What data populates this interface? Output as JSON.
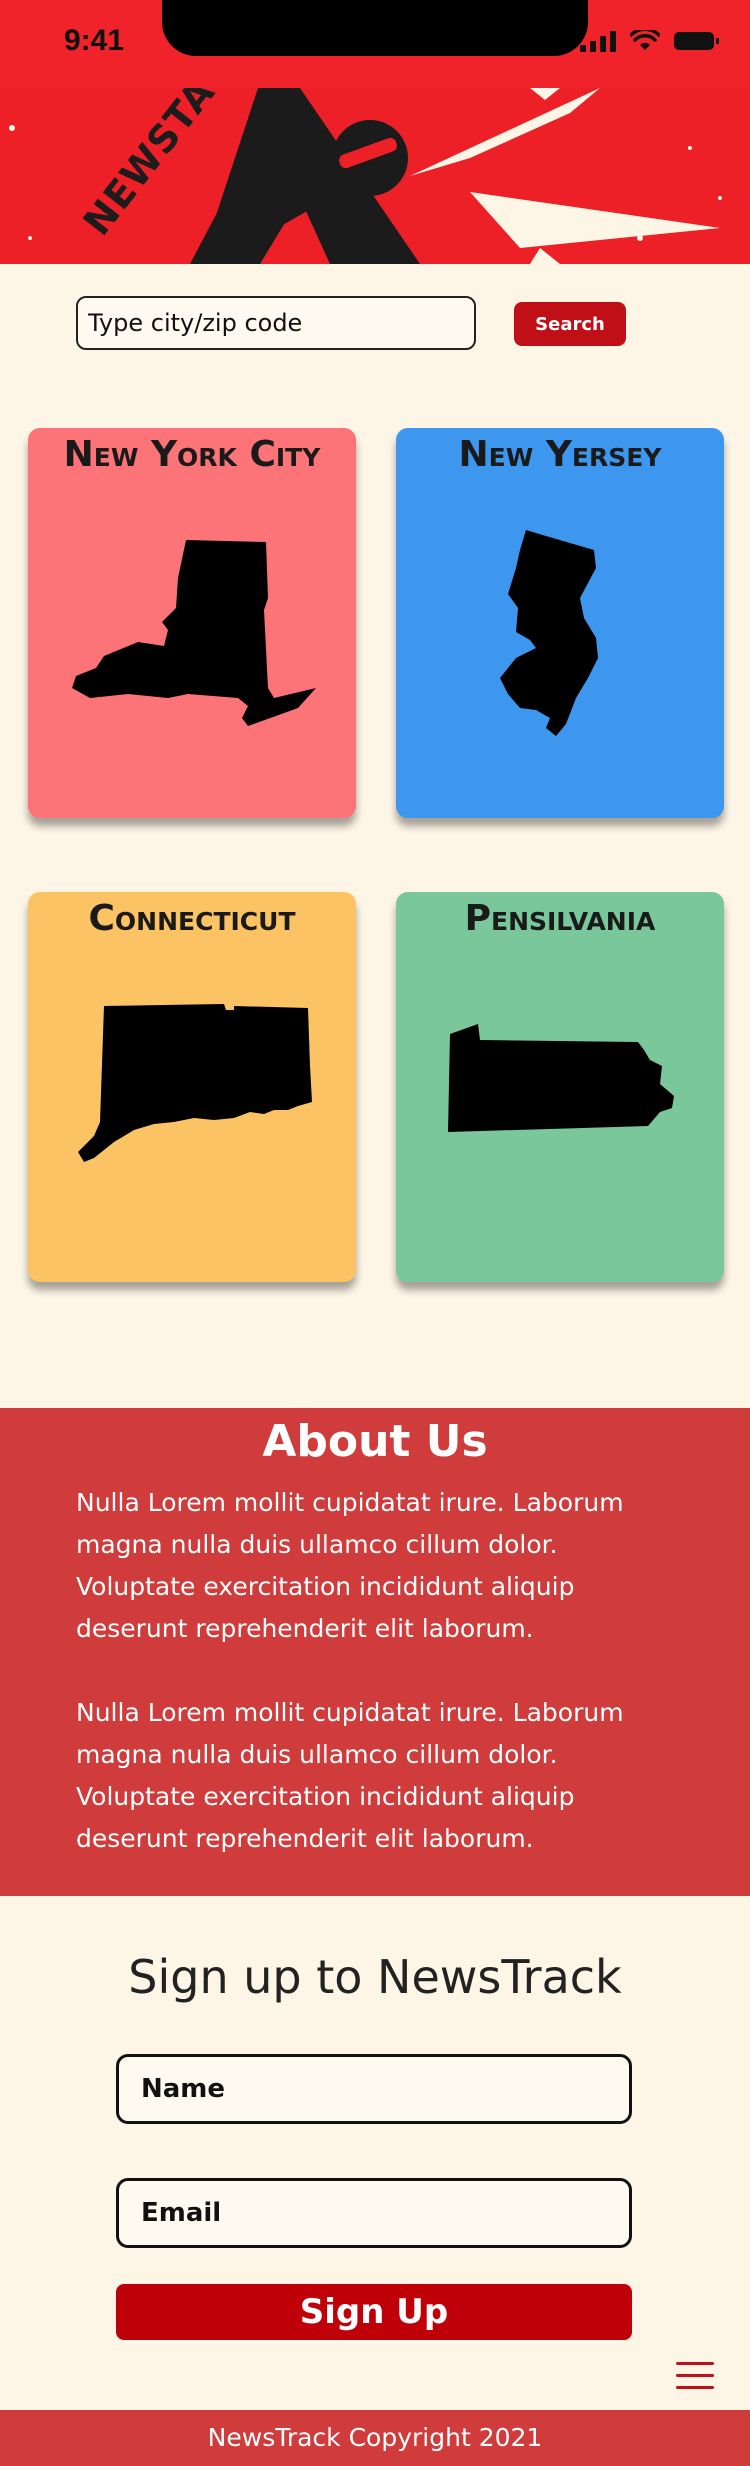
{
  "status_bar": {
    "time": "9:41"
  },
  "banner": {
    "logo_text": "NEWSTACK"
  },
  "search": {
    "placeholder": "Type city/zip code",
    "button_label": "Search"
  },
  "cards": [
    {
      "title": "New York City",
      "color": "#fd7478",
      "map_icon": "new-york-state-icon"
    },
    {
      "title": "New Yersey",
      "color": "#3d97ee",
      "map_icon": "new-jersey-state-icon"
    },
    {
      "title": "Connecticut",
      "color": "#fbc363",
      "map_icon": "connecticut-state-icon"
    },
    {
      "title": "Pensilvania",
      "color": "#79c79b",
      "map_icon": "pennsylvania-state-icon"
    }
  ],
  "about": {
    "title": "About Us",
    "paragraphs": [
      "Nulla Lorem mollit cupidatat irure. Laborum magna nulla duis ullamco cillum dolor. Voluptate exercitation incididunt aliquip deserunt reprehenderit elit laborum.",
      "Nulla Lorem mollit cupidatat irure. Laborum magna nulla duis ullamco cillum dolor. Voluptate exercitation incididunt aliquip deserunt reprehenderit elit laborum."
    ]
  },
  "signup": {
    "title": "Sign up to NewsTrack",
    "name_placeholder": "Name",
    "email_placeholder": "Email",
    "button_label": "Sign Up"
  },
  "footer": {
    "copyright": "NewsTrack Copyright 2021"
  },
  "colors": {
    "brand_red": "#ee2027",
    "button_red": "#c00f16",
    "section_red": "#d03b3b",
    "background": "#fdf5e6"
  }
}
